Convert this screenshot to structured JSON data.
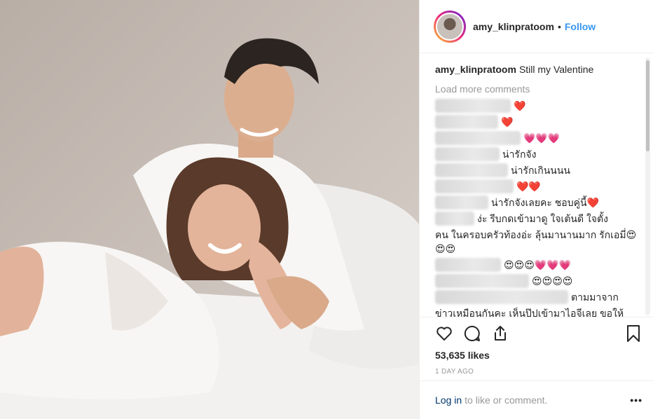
{
  "post": {
    "username": "amy_klinpratoom",
    "follow_label": "Follow",
    "dot": "•"
  },
  "caption": {
    "username": "amy_klinpratoom",
    "text": "Still my Valentine"
  },
  "load_more_label": "Load more comments",
  "comments": [
    {
      "text": "❤️",
      "blur_width": 108
    },
    {
      "text": "❤️",
      "blur_width": 90
    },
    {
      "text": "💗💗💗",
      "blur_width": 122
    },
    {
      "text": "น่ารักจัง",
      "blur_width": 92
    },
    {
      "text": "น่ารักเกินนนน",
      "blur_width": 104
    },
    {
      "text": "❤️❤️",
      "blur_width": 112
    },
    {
      "text": "น่ารักจังเลยคะ ชอบคู่นี้❤️",
      "blur_width": 76
    },
    {
      "text": "ง่ะ รีบกดเข้ามาดู ใจเต้นดี ใจตั้ง",
      "blur_width": 56
    },
    {
      "text": "คน ในครอบครัวท้องอ่ะ ลุ้นมานานมาก รักเอมี่😍😍😍",
      "blur_width": 0
    },
    {
      "text": "😍😍😍💗💗💗",
      "blur_width": 94
    },
    {
      "text": "😍😍😍😍",
      "blur_width": 134
    },
    {
      "text": "ตามมาจาก",
      "blur_width": 190
    },
    {
      "text": "ข่าวเหมือนกันคะ เห็นปุ๊ปเข้ามาไอจีเลย ขอให้",
      "blur_width": 0
    }
  ],
  "actions": {
    "like_icon": "heart-icon",
    "comment_icon": "comment-icon",
    "share_icon": "share-icon",
    "save_icon": "bookmark-icon"
  },
  "likes": "53,635 likes",
  "time": "1 DAY AGO",
  "footer": {
    "login_label": "Log in",
    "rest": "to like or comment.",
    "more": "•••"
  },
  "colors": {
    "link_blue": "#3897f0",
    "muted_gray": "#999999",
    "border": "#efefef"
  }
}
